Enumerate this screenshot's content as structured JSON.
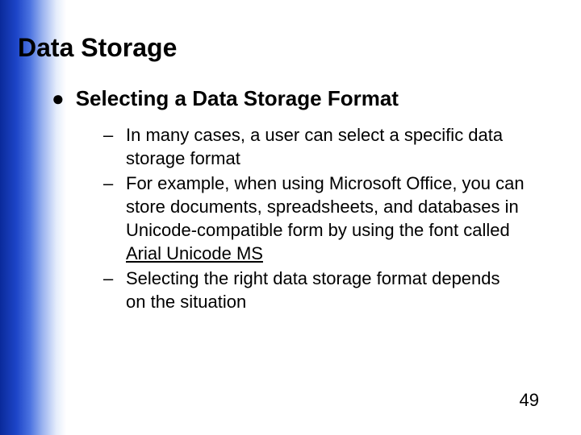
{
  "slide": {
    "title": "Data Storage",
    "level1": {
      "bullet": "●",
      "text": "Selecting a Data Storage Format"
    },
    "level2": [
      {
        "dash": "–",
        "text_before": "In many cases, a user can select a specific data storage format",
        "underlined": "",
        "text_after": ""
      },
      {
        "dash": "–",
        "text_before": "For example, when using Microsoft Office, you can store documents, spreadsheets, and databases in Unicode-compatible form by using the font called ",
        "underlined": "Arial Unicode MS",
        "text_after": ""
      },
      {
        "dash": "–",
        "text_before": "Selecting the right data storage format depends on the situation",
        "underlined": "",
        "text_after": ""
      }
    ],
    "page_number": "49"
  }
}
